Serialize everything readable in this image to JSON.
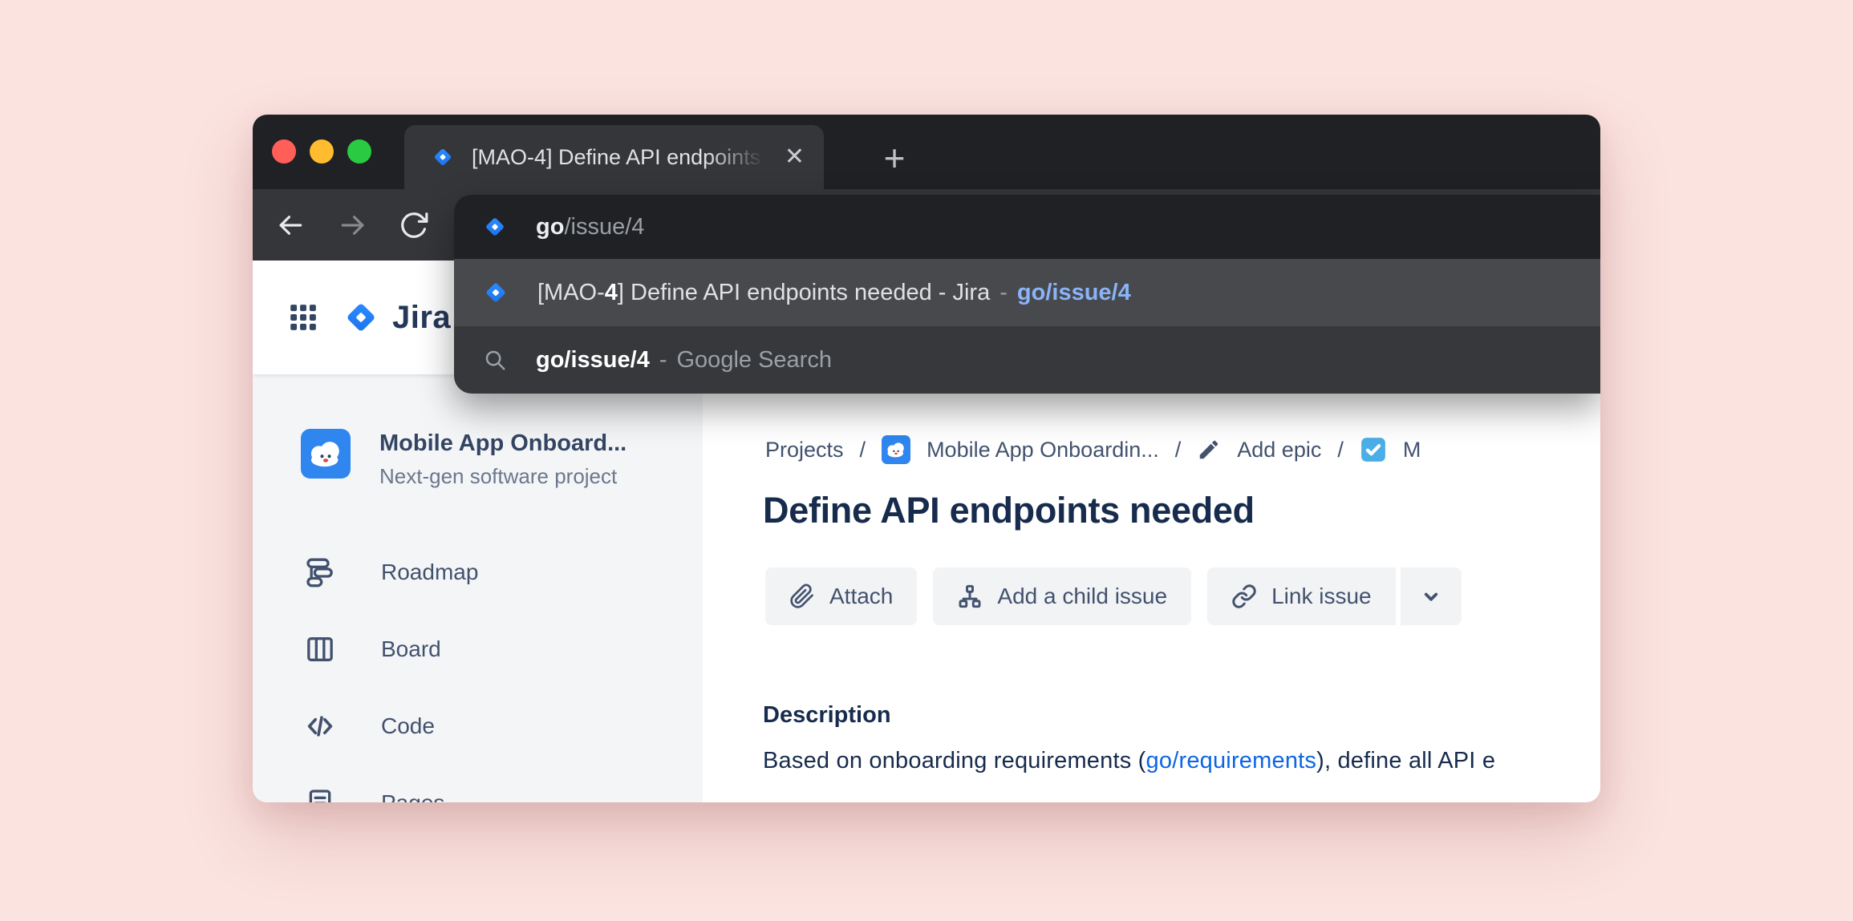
{
  "colors": {
    "page_background": "#fbe3e0",
    "tabstrip_bg": "#202124",
    "toolbar_bg": "#35363a",
    "suggestion_selected_bg": "#47494d",
    "suggestion_bg": "#37383c",
    "jira_brand_blue": "#2684ff",
    "sidebar_bg": "#f4f5f7",
    "heading_navy": "#172b4d",
    "link_blue": "#0c66e4",
    "omnibox_url_blue": "#8ab4f8"
  },
  "browser": {
    "window_controls": [
      "close",
      "minimize",
      "maximize"
    ],
    "tab": {
      "title": "[MAO-4] Define API endpoints",
      "close_glyph": "✕",
      "new_tab_glyph": "+"
    },
    "omnibox": {
      "typed": "go",
      "completion": "/issue/4",
      "suggestions": {
        "primary": {
          "title_pre": "[MAO-",
          "title_match": "4",
          "title_post": "] Define API endpoints needed - Jira",
          "dash": "-",
          "url": "go/issue/4"
        },
        "search": {
          "query": "go/issue/4",
          "dash": "-",
          "engine": "Google Search"
        }
      }
    }
  },
  "jira": {
    "wordmark": "Jira",
    "sidebar": {
      "project_name": "Mobile App Onboard...",
      "project_subtitle": "Next-gen software project",
      "items": [
        {
          "label": "Roadmap"
        },
        {
          "label": "Board"
        },
        {
          "label": "Code"
        },
        {
          "label": "Pages"
        }
      ]
    },
    "breadcrumb": {
      "projects": "Projects",
      "separator": "/",
      "project": "Mobile App Onboardin...",
      "epic": "Add epic",
      "issue_truncated": "M"
    },
    "issue": {
      "title": "Define API endpoints needed",
      "actions": {
        "attach": "Attach",
        "add_child": "Add a child issue",
        "link": "Link issue"
      },
      "description_heading": "Description",
      "description": {
        "pre": "Based on onboarding requirements (",
        "link": "go/requirements",
        "post": "), define all API e"
      }
    }
  }
}
